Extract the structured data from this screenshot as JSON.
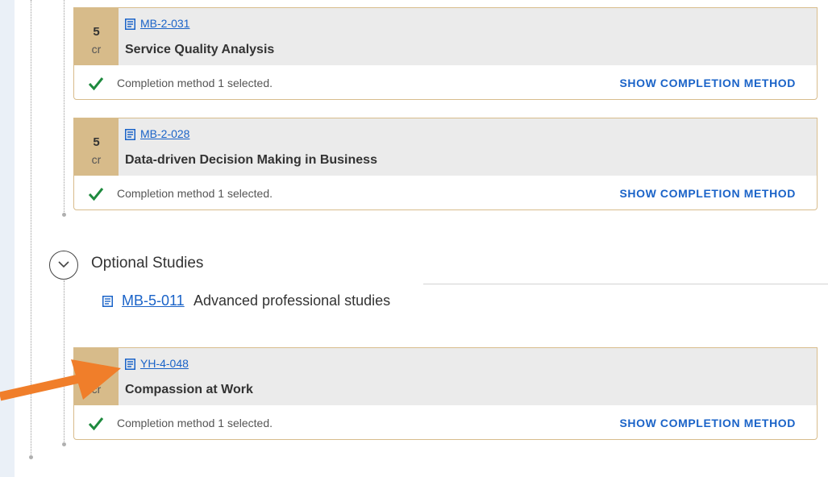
{
  "accent_color": "#1a63c8",
  "credit_bg_color": "#d7bb8a",
  "arrow_color": "#f07e2a",
  "courses_top": [
    {
      "credits": "5",
      "credit_unit": "cr",
      "code": "MB-2-031",
      "title": "Service Quality Analysis",
      "status": "Completion method 1 selected.",
      "action": "SHOW COMPLETION METHOD"
    },
    {
      "credits": "5",
      "credit_unit": "cr",
      "code": "MB-2-028",
      "title": "Data-driven Decision Making in Business",
      "status": "Completion method 1 selected.",
      "action": "SHOW COMPLETION METHOD"
    }
  ],
  "optional_section": {
    "title": "Optional Studies",
    "module_code": "MB-5-011",
    "module_name": "Advanced professional studies",
    "toggle_icon": "chevron-down-icon"
  },
  "course_bottom": {
    "credit_unit": "cr",
    "code": "YH-4-048",
    "title": "Compassion at Work",
    "status": "Completion method 1 selected.",
    "action": "SHOW COMPLETION METHOD"
  }
}
